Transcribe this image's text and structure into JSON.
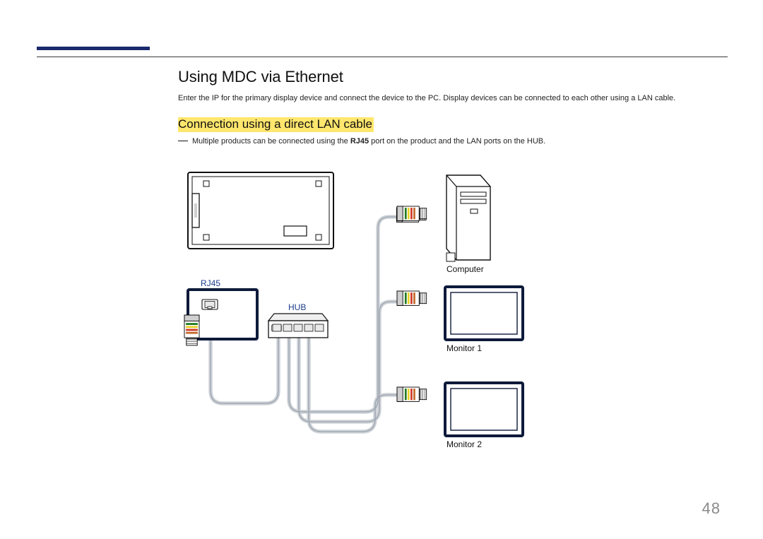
{
  "page": {
    "title": "Using MDC via Ethernet",
    "intro": "Enter the IP for the primary display device and connect the device to the PC. Display devices can be connected to each other using a LAN cable.",
    "subtitle": "Connection using a direct LAN cable",
    "note_prefix": "Multiple products can be connected using the ",
    "note_bold": "RJ45",
    "note_suffix": " port on the product and the LAN ports on the HUB.",
    "number": "48"
  },
  "diagram": {
    "labels": {
      "rj45": "RJ45",
      "hub": "HUB",
      "computer": "Computer",
      "monitor1": "Monitor 1",
      "monitor2": "Monitor 2"
    }
  }
}
